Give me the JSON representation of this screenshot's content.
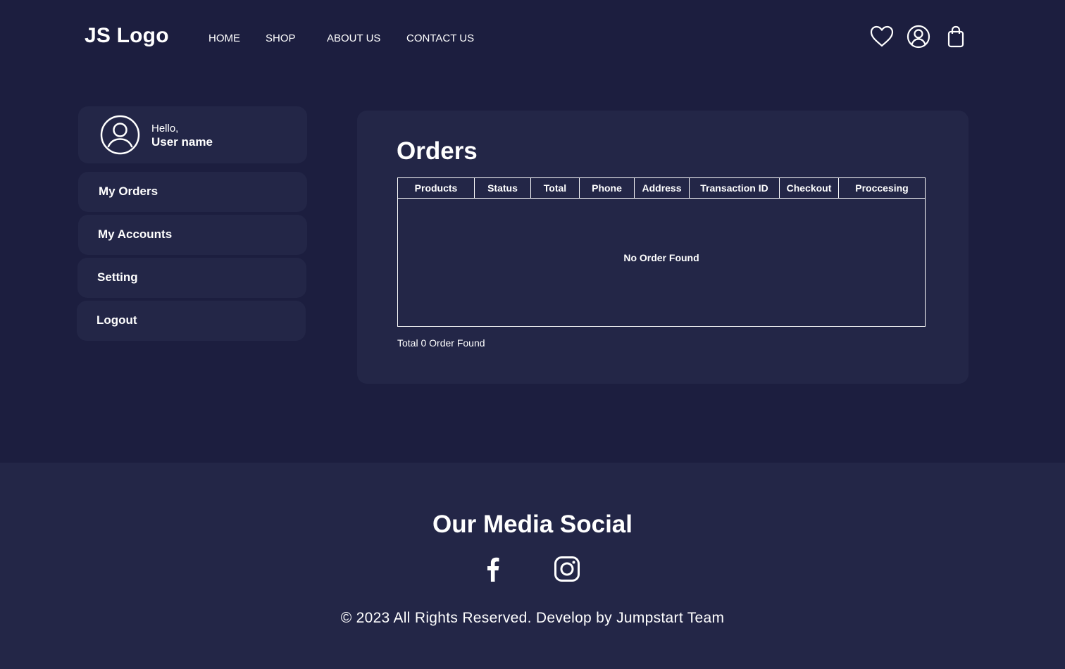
{
  "header": {
    "logo": "JS Logo",
    "nav": {
      "home": "HOME",
      "shop": "SHOP",
      "about": "ABOUT US",
      "contact": "CONTACT US"
    },
    "icons": [
      "heart-icon",
      "user-icon",
      "shopping-bag-icon"
    ]
  },
  "sidebar": {
    "greeting": "Hello,",
    "username": "User name",
    "menu": {
      "orders": "My Orders",
      "accounts": "My Accounts",
      "setting": "Setting",
      "logout": "Logout"
    }
  },
  "orders": {
    "title": "Orders",
    "columns": {
      "products": "Products",
      "status": "Status",
      "total": "Total",
      "phone": "Phone",
      "address": "Address",
      "transaction": "Transaction ID",
      "checkout": "Checkout",
      "processing": "Proccesing"
    },
    "empty_message": "No Order Found",
    "total_text": "Total 0 Order Found"
  },
  "footer": {
    "title": "Our Media Social",
    "social_icons": [
      "facebook-icon",
      "instagram-icon"
    ],
    "copyright": "© 2023 All Rights Reserved. Develop by Jumpstart Team"
  },
  "colors": {
    "background": "#1c1e3f",
    "card": "#232647",
    "text": "#ffffff"
  }
}
